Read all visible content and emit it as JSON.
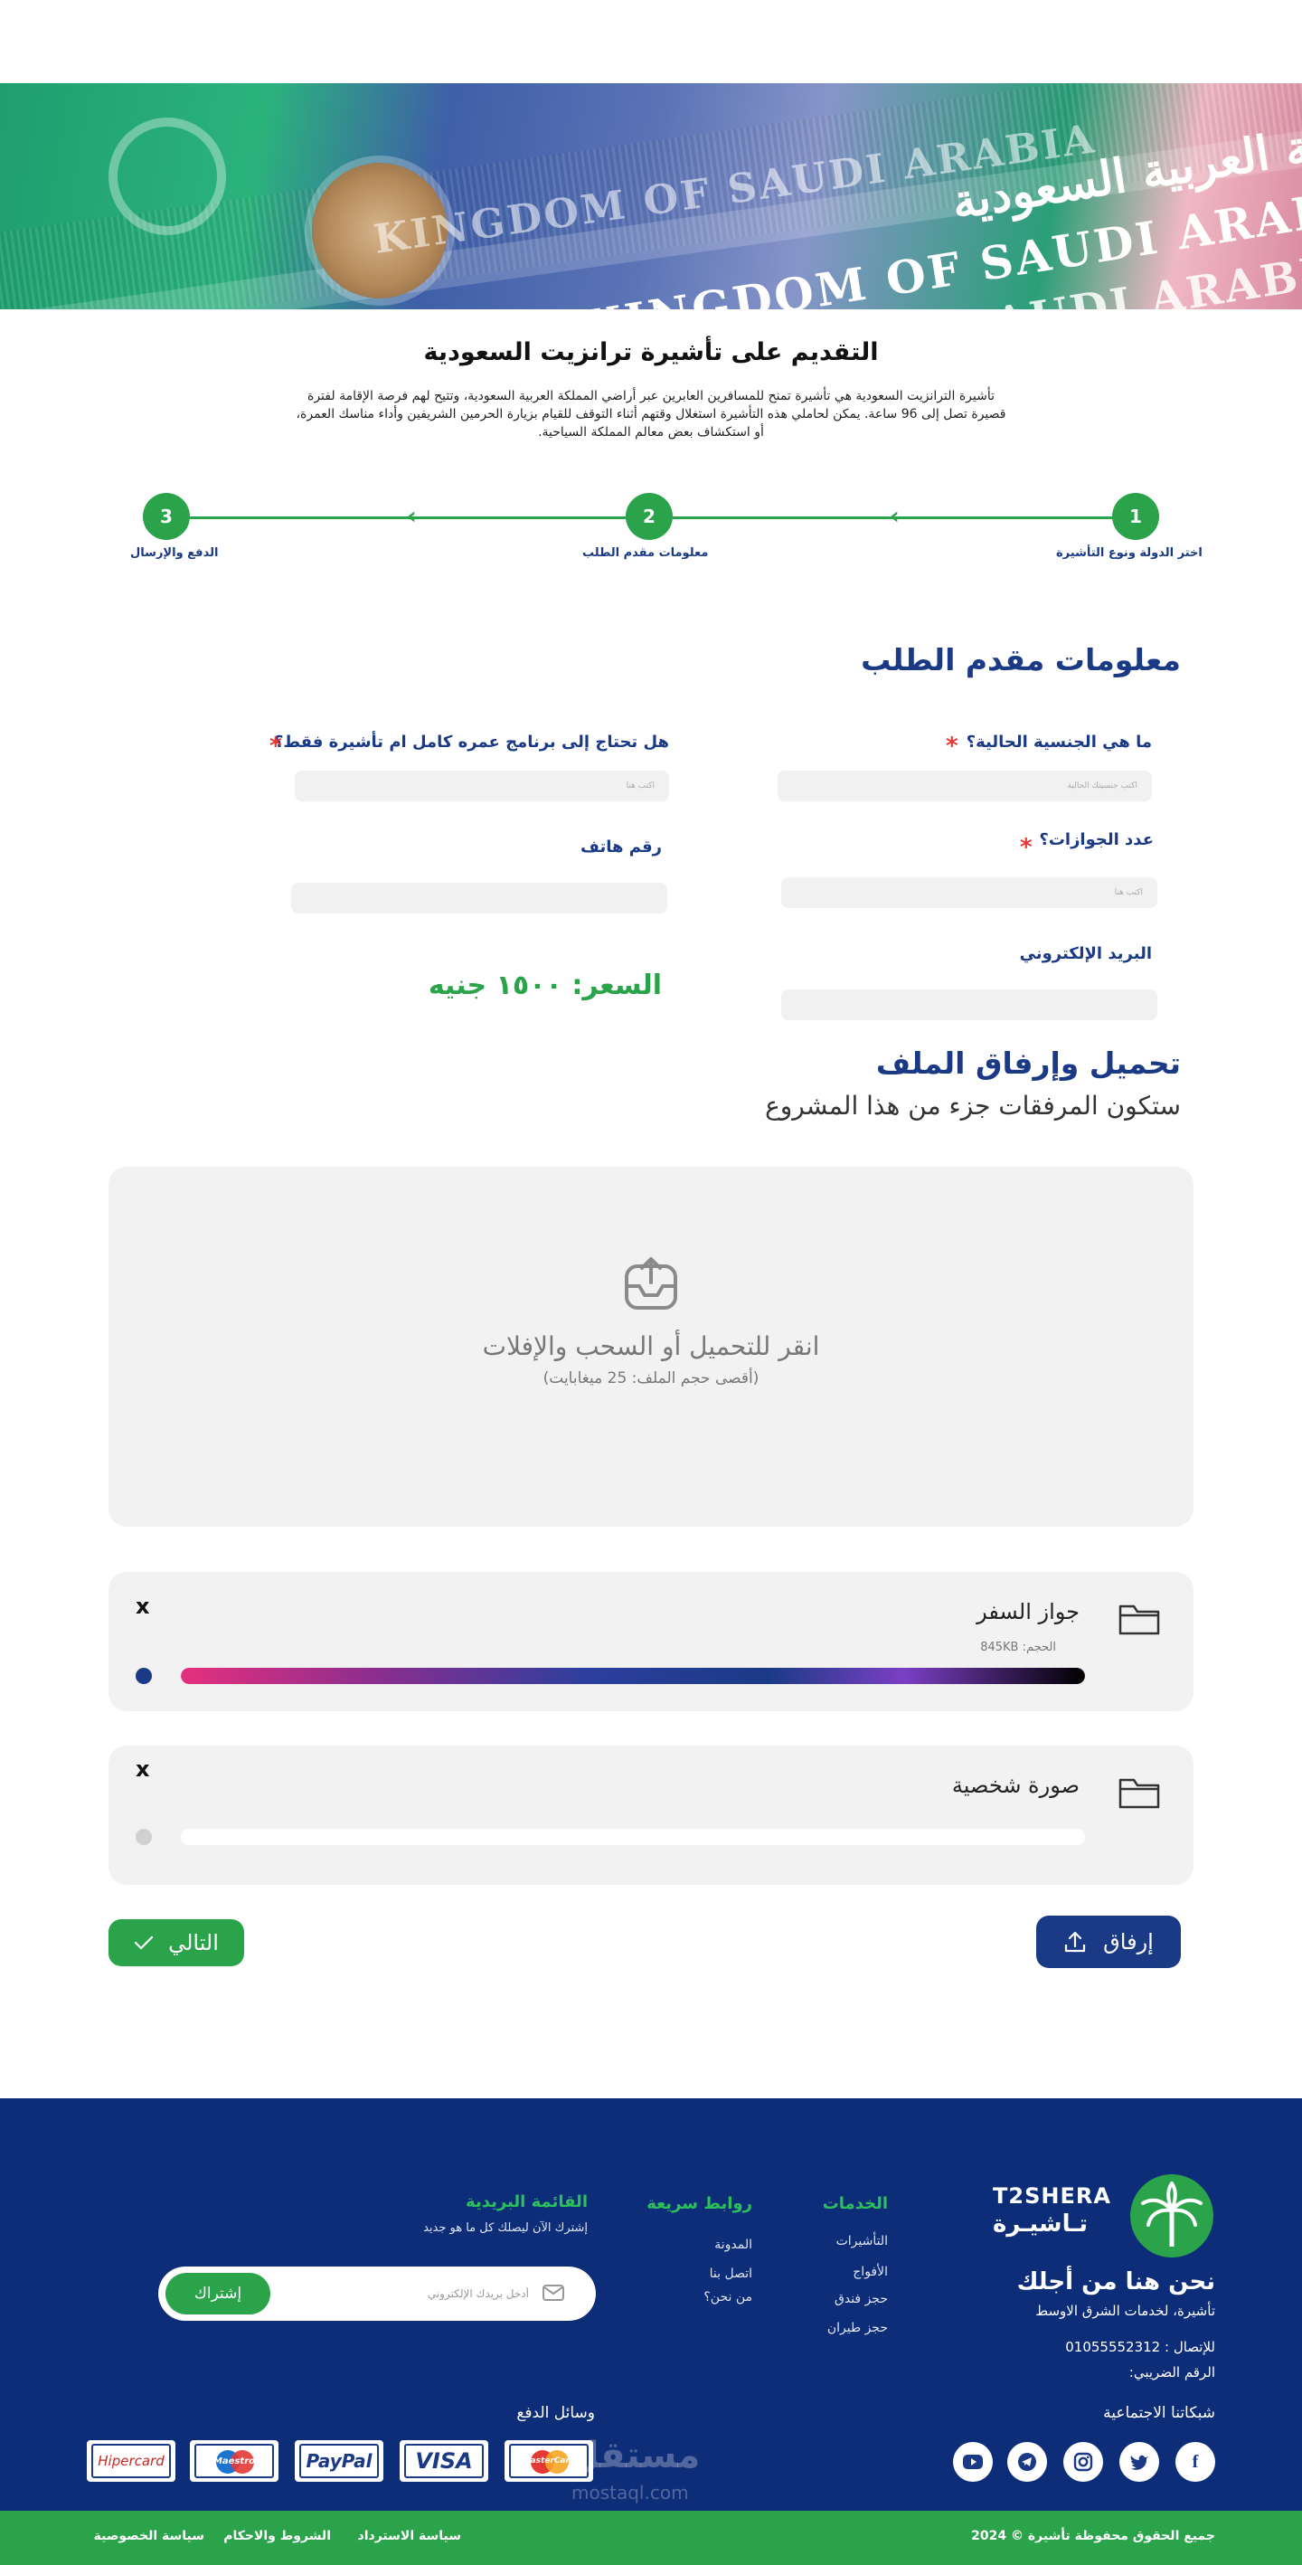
{
  "hero": {
    "text_1": "KINGDOM OF SAUDI ARABIA",
    "text_2": "KINGDOM OF SAUDI ARABIA",
    "text_3": "المملكة العربية السعودية",
    "text_4": "SAUDI ARABIA"
  },
  "page": {
    "title": "التقديم على تأشيرة ترانزيت السعودية",
    "intro": "تأشيرة الترانزيت السعودية هي تأشيرة تمنح للمسافرين العابرين عبر أراضي المملكة العربية السعودية، وتتيح لهم فرصة الإقامة لفترة قصيرة تصل إلى 96 ساعة. يمكن لحاملي هذه التأشيرة استغلال وقتهم أثناء التوقف للقيام بزيارة الحرمين الشريفين وأداء مناسك العمرة، أو استكشاف بعض معالم المملكة السياحية."
  },
  "stepper": {
    "steps": [
      {
        "number": "1",
        "label": "اختر الدولة ونوع التأشيرة"
      },
      {
        "number": "2",
        "label": "معلومات مقدم الطلب"
      },
      {
        "number": "3",
        "label": "الدفع والإرسال"
      }
    ]
  },
  "form": {
    "title": "معلومات مقدم الطلب",
    "nationality_label": "ما هي الجنسية الحالية؟",
    "nationality_placeholder": "اكتب جنسيتك الحالية",
    "program_label": "هل تحتاج إلى برنامج عمره كامل ام تأشيرة فقط؟",
    "program_placeholder": "اكتب هنا",
    "passports_label": "عدد الجوازات؟",
    "passports_placeholder": "اكتب هنا",
    "phone_label": "رقم هاتف",
    "email_label": "البريد الإلكتروني",
    "required_mark": "*",
    "price": "السعر: ١٥٠٠ جنيه"
  },
  "upload": {
    "title": "تحميل وإرفاق الملف",
    "subtitle": "ستكون المرفقات جزء من هذا المشروع",
    "drop_text": "انقر للتحميل أو السحب والإفلات",
    "drop_hint": "(أقصى حجم الملف: 25 ميغابايت)",
    "files": [
      {
        "name": "جواز السفر",
        "size": "الحجم: 845KB",
        "progress": 1.0,
        "close": "x",
        "dot_color": "#1b3a86"
      },
      {
        "name": "صورة شخصية",
        "size": "",
        "progress": 0.0,
        "close": "x",
        "dot_color": "#d0d0d0"
      }
    ],
    "attach_button": "إرفاق",
    "next_button": "التالي"
  },
  "footer": {
    "brand_en": "T2SHERA",
    "brand_ar": "تـاشيـرة",
    "headline": "نحن هنا من أجلك",
    "tagline": "تأشيرة، لخدمات الشرق الاوسط",
    "contact": "للإتصال : 01055552312",
    "tax": "الرقم الضريبي:",
    "social_title": "شبكاتنا الاجتماعية",
    "services_title": "الخدمات",
    "services": [
      "التأشيرات",
      "الأفواج",
      "حجز فندق",
      "حجز طيران"
    ],
    "links_title": "روابط سريعة",
    "links": [
      "المدونة",
      "اتصل بنا",
      "من نحن؟"
    ],
    "newsletter_title": "القائمة البريدية",
    "newsletter_text": "إشترك الآن ليصلك كل ما هو جديد",
    "newsletter_placeholder": "أدخل بريدك الإلكتروني",
    "newsletter_button": "إشتراك",
    "payment_title": "وسائل الدفع",
    "payments": [
      "Hipercard",
      "Maestro",
      "PayPal",
      "VISA",
      "MasterCard"
    ],
    "watermark": "مستقل",
    "watermark_sub": "mostaql.com",
    "copyright": "جميع الحقوق محفوظة تأشيرة © 2024",
    "refund": "سياسة الاسترداد",
    "terms": "الشروط والاحكام",
    "privacy": "سياسة الخصوصية"
  },
  "colors": {
    "brand_blue": "#1b3a86",
    "brand_green": "#2aa34a",
    "footer_bg": "#0e2d78",
    "required_red": "#e53935"
  }
}
